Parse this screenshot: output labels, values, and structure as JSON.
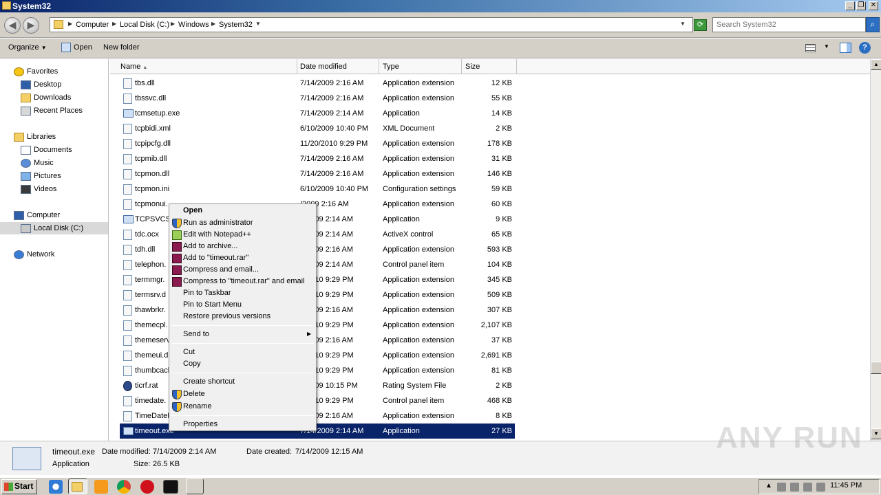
{
  "window": {
    "title": "System32"
  },
  "address": {
    "crumbs": [
      "Computer",
      "Local Disk (C:)",
      "Windows",
      "System32"
    ]
  },
  "search": {
    "placeholder": "Search System32"
  },
  "toolbar": {
    "organize": "Organize",
    "open": "Open",
    "new_folder": "New folder"
  },
  "nav": {
    "favorites": "Favorites",
    "desktop": "Desktop",
    "downloads": "Downloads",
    "recent_places": "Recent Places",
    "libraries": "Libraries",
    "documents": "Documents",
    "music": "Music",
    "pictures": "Pictures",
    "videos": "Videos",
    "computer": "Computer",
    "local_disk": "Local Disk (C:)",
    "network": "Network"
  },
  "columns": {
    "name": "Name",
    "date": "Date modified",
    "type": "Type",
    "size": "Size"
  },
  "files": [
    {
      "name": "tbs.dll",
      "date": "7/14/2009 2:16 AM",
      "type": "Application extension",
      "size": "12 KB",
      "icon": "dll"
    },
    {
      "name": "tbssvc.dll",
      "date": "7/14/2009 2:16 AM",
      "type": "Application extension",
      "size": "55 KB",
      "icon": "dll"
    },
    {
      "name": "tcmsetup.exe",
      "date": "7/14/2009 2:14 AM",
      "type": "Application",
      "size": "14 KB",
      "icon": "exe"
    },
    {
      "name": "tcpbidi.xml",
      "date": "6/10/2009 10:40 PM",
      "type": "XML Document",
      "size": "2 KB",
      "icon": "xml"
    },
    {
      "name": "tcpipcfg.dll",
      "date": "11/20/2010 9:29 PM",
      "type": "Application extension",
      "size": "178 KB",
      "icon": "dll"
    },
    {
      "name": "tcpmib.dll",
      "date": "7/14/2009 2:16 AM",
      "type": "Application extension",
      "size": "31 KB",
      "icon": "dll"
    },
    {
      "name": "tcpmon.dll",
      "date": "7/14/2009 2:16 AM",
      "type": "Application extension",
      "size": "146 KB",
      "icon": "dll"
    },
    {
      "name": "tcpmon.ini",
      "date": "6/10/2009 10:40 PM",
      "type": "Configuration settings",
      "size": "59 KB",
      "icon": "ini"
    },
    {
      "name": "tcpmonui.",
      "date": "/2009 2:16 AM",
      "type": "Application extension",
      "size": "60 KB",
      "icon": "dll"
    },
    {
      "name": "TCPSVCS.",
      "date": "7/2009 2:14 AM",
      "type": "Application",
      "size": "9 KB",
      "icon": "exe"
    },
    {
      "name": "tdc.ocx",
      "date": "7/2009 2:14 AM",
      "type": "ActiveX control",
      "size": "65 KB",
      "icon": "dll"
    },
    {
      "name": "tdh.dll",
      "date": "7/2009 2:16 AM",
      "type": "Application extension",
      "size": "593 KB",
      "icon": "dll"
    },
    {
      "name": "telephon.",
      "date": "7/2009 2:14 AM",
      "type": "Control panel item",
      "size": "104 KB",
      "icon": "dll"
    },
    {
      "name": "termmgr.",
      "date": "0/2010 9:29 PM",
      "type": "Application extension",
      "size": "345 KB",
      "icon": "dll"
    },
    {
      "name": "termsrv.d",
      "date": "0/2010 9:29 PM",
      "type": "Application extension",
      "size": "509 KB",
      "icon": "dll"
    },
    {
      "name": "thawbrkr.",
      "date": "7/2009 2:16 AM",
      "type": "Application extension",
      "size": "307 KB",
      "icon": "dll"
    },
    {
      "name": "themecpl.",
      "date": "0/2010 9:29 PM",
      "type": "Application extension",
      "size": "2,107 KB",
      "icon": "dll"
    },
    {
      "name": "themeserv",
      "date": "7/2009 2:16 AM",
      "type": "Application extension",
      "size": "37 KB",
      "icon": "dll"
    },
    {
      "name": "themeui.d",
      "date": "0/2010 9:29 PM",
      "type": "Application extension",
      "size": "2,691 KB",
      "icon": "dll"
    },
    {
      "name": "thumbcacl",
      "date": "0/2010 9:29 PM",
      "type": "Application extension",
      "size": "81 KB",
      "icon": "dll"
    },
    {
      "name": "ticrf.rat",
      "date": "7/2009 10:15 PM",
      "type": "Rating System File",
      "size": "2 KB",
      "icon": "rat"
    },
    {
      "name": "timedate.",
      "date": "0/2010 9:29 PM",
      "type": "Control panel item",
      "size": "468 KB",
      "icon": "dll"
    },
    {
      "name": "TimeDateM",
      "date": "7/2009 2:16 AM",
      "type": "Application extension",
      "size": "8 KB",
      "icon": "dll"
    },
    {
      "name": "timeout.exe",
      "date": "7/14/2009 2:14 AM",
      "type": "Application",
      "size": "27 KB",
      "icon": "exe",
      "selected": true
    }
  ],
  "context_menu": {
    "open": "Open",
    "run_as_admin": "Run as administrator",
    "edit_notepad": "Edit with Notepad++",
    "add_archive": "Add to archive...",
    "add_rar": "Add to \"timeout.rar\"",
    "compress_email": "Compress and email...",
    "compress_rar_email": "Compress to \"timeout.rar\" and email",
    "pin_taskbar": "Pin to Taskbar",
    "pin_start": "Pin to Start Menu",
    "restore": "Restore previous versions",
    "send_to": "Send to",
    "cut": "Cut",
    "copy": "Copy",
    "create_shortcut": "Create shortcut",
    "delete": "Delete",
    "rename": "Rename",
    "properties": "Properties"
  },
  "details": {
    "name": "timeout.exe",
    "type": "Application",
    "date_modified_label": "Date modified:",
    "date_modified": "7/14/2009 2:14 AM",
    "date_created_label": "Date created:",
    "date_created": "7/14/2009 12:15 AM",
    "size_label": "Size:",
    "size": "26.5 KB"
  },
  "taskbar": {
    "start": "Start",
    "clock": "11:45 PM"
  },
  "watermark": "ANY RUN",
  "colors": {
    "selection": "#0a246a",
    "chrome": "#d4d0c8"
  }
}
